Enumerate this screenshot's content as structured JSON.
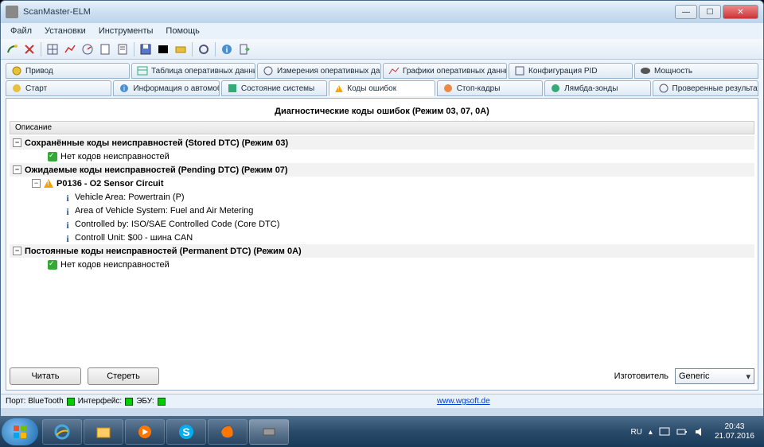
{
  "window": {
    "title": "ScanMaster-ELM"
  },
  "menu": {
    "file": "Файл",
    "setup": "Установки",
    "tools": "Инструменты",
    "help": "Помощь"
  },
  "tabs_top": [
    {
      "label": "Привод",
      "icon": "gear"
    },
    {
      "label": "Таблица оперативных данных",
      "icon": "table"
    },
    {
      "label": "Измерения оперативных данных",
      "icon": "gauge"
    },
    {
      "label": "Графики оперативных данных",
      "icon": "chart"
    },
    {
      "label": "Конфигурация PID",
      "icon": "config"
    },
    {
      "label": "Мощность",
      "icon": "power"
    }
  ],
  "tabs_bottom": [
    {
      "label": "Старт",
      "icon": "play",
      "active": false
    },
    {
      "label": "Информация о автомобиле",
      "icon": "info",
      "active": false
    },
    {
      "label": "Состояние системы",
      "icon": "status",
      "active": false
    },
    {
      "label": "Коды ошибок",
      "icon": "warn",
      "active": true
    },
    {
      "label": "Стоп-кадры",
      "icon": "freeze",
      "active": false
    },
    {
      "label": "Лямбда-зонды",
      "icon": "lambda",
      "active": false
    },
    {
      "label": "Проверенные результаты теста",
      "icon": "check",
      "active": false
    }
  ],
  "panel": {
    "title": "Диагностические коды ошибок (Режим 03, 07, 0A)",
    "desc_header": "Описание"
  },
  "tree": {
    "stored": {
      "label": "Сохранённые коды неисправностей (Stored DTC) (Режим 03)",
      "none": "Нет кодов неисправностей"
    },
    "pending": {
      "label": "Ожидаемые коды неисправностей (Pending DTC) (Режим 07)",
      "code": "P0136 - O2 Sensor Circuit",
      "d1": "Vehicle Area: Powertrain (P)",
      "d2": "Area of Vehicle System: Fuel and Air Metering",
      "d3": "Controlled by: ISO/SAE Controlled Code (Core DTC)",
      "d4": "Controll Unit: $00 - шина CAN"
    },
    "permanent": {
      "label": "Постоянные коды неисправностей (Permanent DTC) (Режим 0A)",
      "none": "Нет кодов неисправностей"
    }
  },
  "buttons": {
    "read": "Читать",
    "erase": "Стереть"
  },
  "manufacturer": {
    "label": "Изготовитель",
    "value": "Generic"
  },
  "status": {
    "port": "Порт: BlueTooth",
    "iface": "Интерфейс:",
    "ecu": "ЭБУ:",
    "link": "www.wgsoft.de"
  },
  "tray": {
    "lang": "RU",
    "time": "20:43",
    "date": "21.07.2016"
  }
}
